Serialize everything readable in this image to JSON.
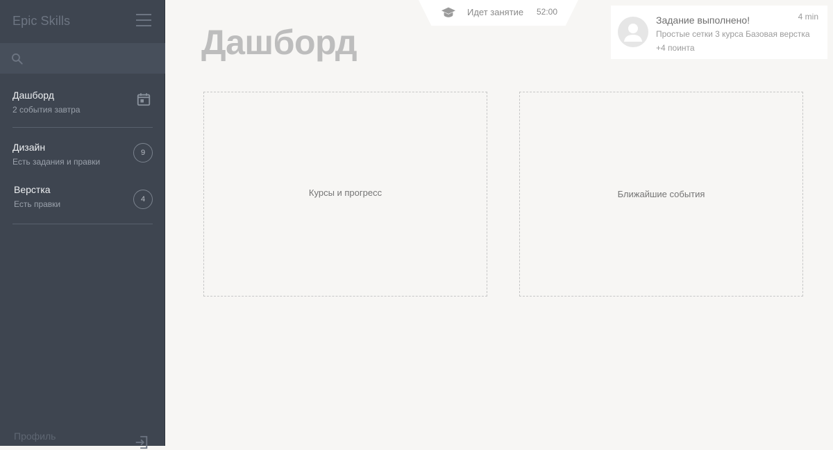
{
  "sidebar": {
    "brand": "Epic Skills",
    "search": {
      "placeholder": "",
      "value": ""
    },
    "items": [
      {
        "label": "Дашборд",
        "subtitle": "2 события завтра",
        "icon": "calendar-icon"
      },
      {
        "label": "Дизайн",
        "subtitle": "Есть задания и правки",
        "badge": "9"
      },
      {
        "label": "Верстка",
        "subtitle": "Есть правки",
        "badge": "4"
      }
    ],
    "profile_label": "Профиль"
  },
  "header": {
    "page_title": "Дашборд",
    "lesson": {
      "label": "Идет занятие",
      "timer": "52:00",
      "icon": "graduation-cap-icon"
    }
  },
  "notification": {
    "title": "Задание выполнено!",
    "time": "4 min",
    "line1": "Простые сетки 3 курса Базовая верстка",
    "line2": "+4 поинта",
    "icon": "user-avatar-icon"
  },
  "panels": {
    "courses": "Курсы и прогресс",
    "events": "Ближайшие события"
  },
  "colors": {
    "sidebar_bg": "#3e4550",
    "search_bg": "#474f5b",
    "page_bg": "#f7f6f4",
    "title": "#bdbdbd"
  }
}
